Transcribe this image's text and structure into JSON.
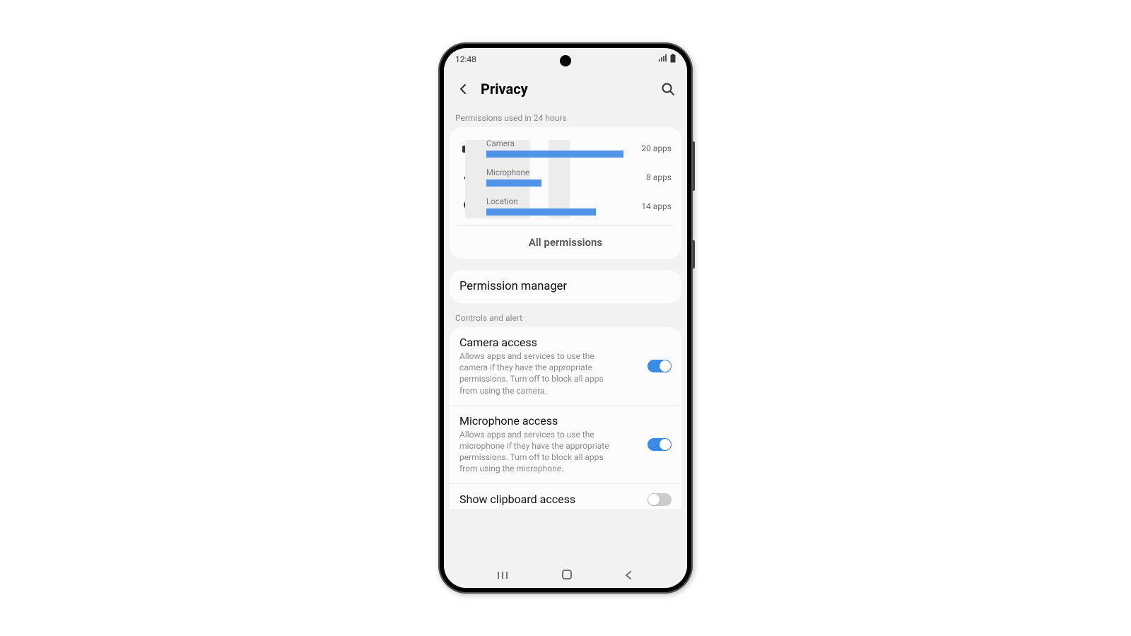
{
  "status": {
    "time": "12:48"
  },
  "header": {
    "title": "Privacy"
  },
  "permissions_section": {
    "label": "Permissions used in 24 hours",
    "items": [
      {
        "icon": "camera-icon",
        "label": "Camera",
        "count": "20 apps",
        "bar_pct": 100
      },
      {
        "icon": "microphone-icon",
        "label": "Microphone",
        "count": "8 apps",
        "bar_pct": 40
      },
      {
        "icon": "location-icon",
        "label": "Location",
        "count": "14 apps",
        "bar_pct": 80
      }
    ],
    "all_label": "All permissions"
  },
  "permission_manager": {
    "title": "Permission manager"
  },
  "controls_section": {
    "label": "Controls and alert",
    "items": [
      {
        "title": "Camera access",
        "desc": "Allows apps and services to use the camera if they have the appropriate permissions. Turn off to block all apps from using the camera.",
        "on": true
      },
      {
        "title": "Microphone access",
        "desc": "Allows apps and services to use the microphone if they have the appropriate permissions. Turn off to block all apps from using the microphone.",
        "on": true
      },
      {
        "title": "Show clipboard access",
        "desc": "",
        "on": false
      }
    ]
  },
  "chart_data": {
    "type": "bar",
    "title": "Permissions used in 24 hours",
    "categories": [
      "Camera",
      "Microphone",
      "Location"
    ],
    "values": [
      20,
      8,
      14
    ],
    "ylabel": "apps",
    "ylim": [
      0,
      20
    ]
  }
}
